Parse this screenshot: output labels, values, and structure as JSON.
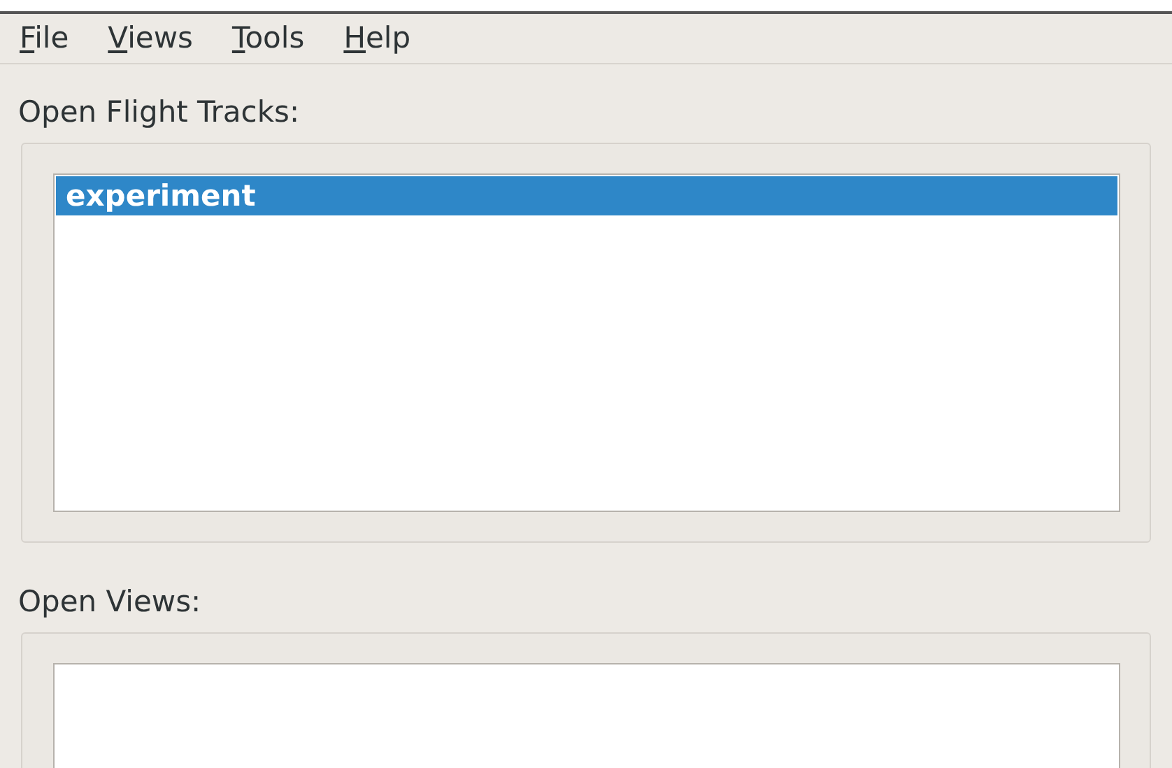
{
  "menu_bar": [
    {
      "label": "File"
    },
    {
      "label": "Views"
    },
    {
      "label": "Tools"
    },
    {
      "label": "Help"
    }
  ],
  "flight_tracks": {
    "label": "Open Flight Tracks:",
    "items": [
      {
        "label": "experiment",
        "selected": true
      }
    ]
  },
  "views": {
    "label": "Open Views:"
  }
}
